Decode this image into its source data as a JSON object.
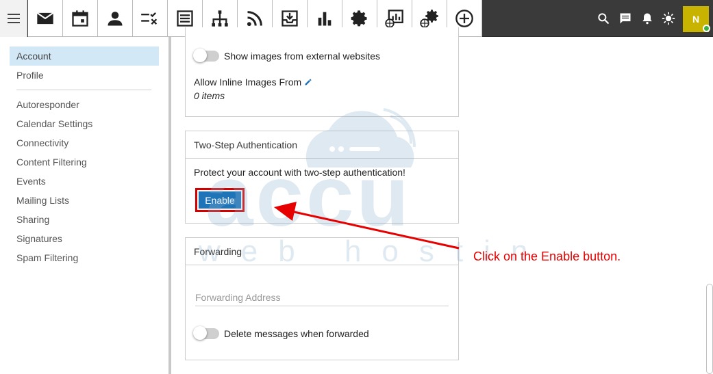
{
  "colors": {
    "topbar": "#3a3a3a",
    "accent": "#1f73b7",
    "sidebar_active": "#d3e8f7",
    "annotation": "#e60000",
    "avatar": "#c8b400",
    "online": "#3cb043"
  },
  "nav": {
    "icons": [
      "mail-icon",
      "calendar-icon",
      "contacts-icon",
      "tasks-icon",
      "notes-icon",
      "sitemap-icon",
      "rss-icon",
      "inbox-download-icon",
      "bar-chart-icon",
      "settings-gear-icon",
      "web-stats-icon",
      "web-settings-icon",
      "add-circle-icon"
    ],
    "active": "settings-gear-icon",
    "right_icons": [
      "search-icon",
      "chat-icon",
      "bell-icon",
      "brightness-icon"
    ],
    "avatar_initial": "N"
  },
  "sidebar": {
    "items": [
      {
        "label": "Account",
        "active": true
      },
      {
        "label": "Profile"
      },
      {
        "label": "Autoresponder"
      },
      {
        "label": "Calendar Settings"
      },
      {
        "label": "Connectivity"
      },
      {
        "label": "Content Filtering"
      },
      {
        "label": "Events"
      },
      {
        "label": "Mailing Lists"
      },
      {
        "label": "Sharing"
      },
      {
        "label": "Signatures"
      },
      {
        "label": "Spam Filtering"
      }
    ]
  },
  "images": {
    "external_toggle_label": "Show images from external websites",
    "inline_label": "Allow Inline Images From",
    "inline_count": "0 items"
  },
  "two_step": {
    "title": "Two-Step Authentication",
    "description": "Protect your account with two-step authentication!",
    "enable_label": "Enable"
  },
  "forwarding": {
    "title": "Forwarding",
    "address_placeholder": "Forwarding Address",
    "delete_toggle_label": "Delete messages when forwarded"
  },
  "annotation": {
    "text": "Click on the Enable button."
  },
  "watermark": {
    "brand": "accu",
    "tagline": "web hosting"
  }
}
